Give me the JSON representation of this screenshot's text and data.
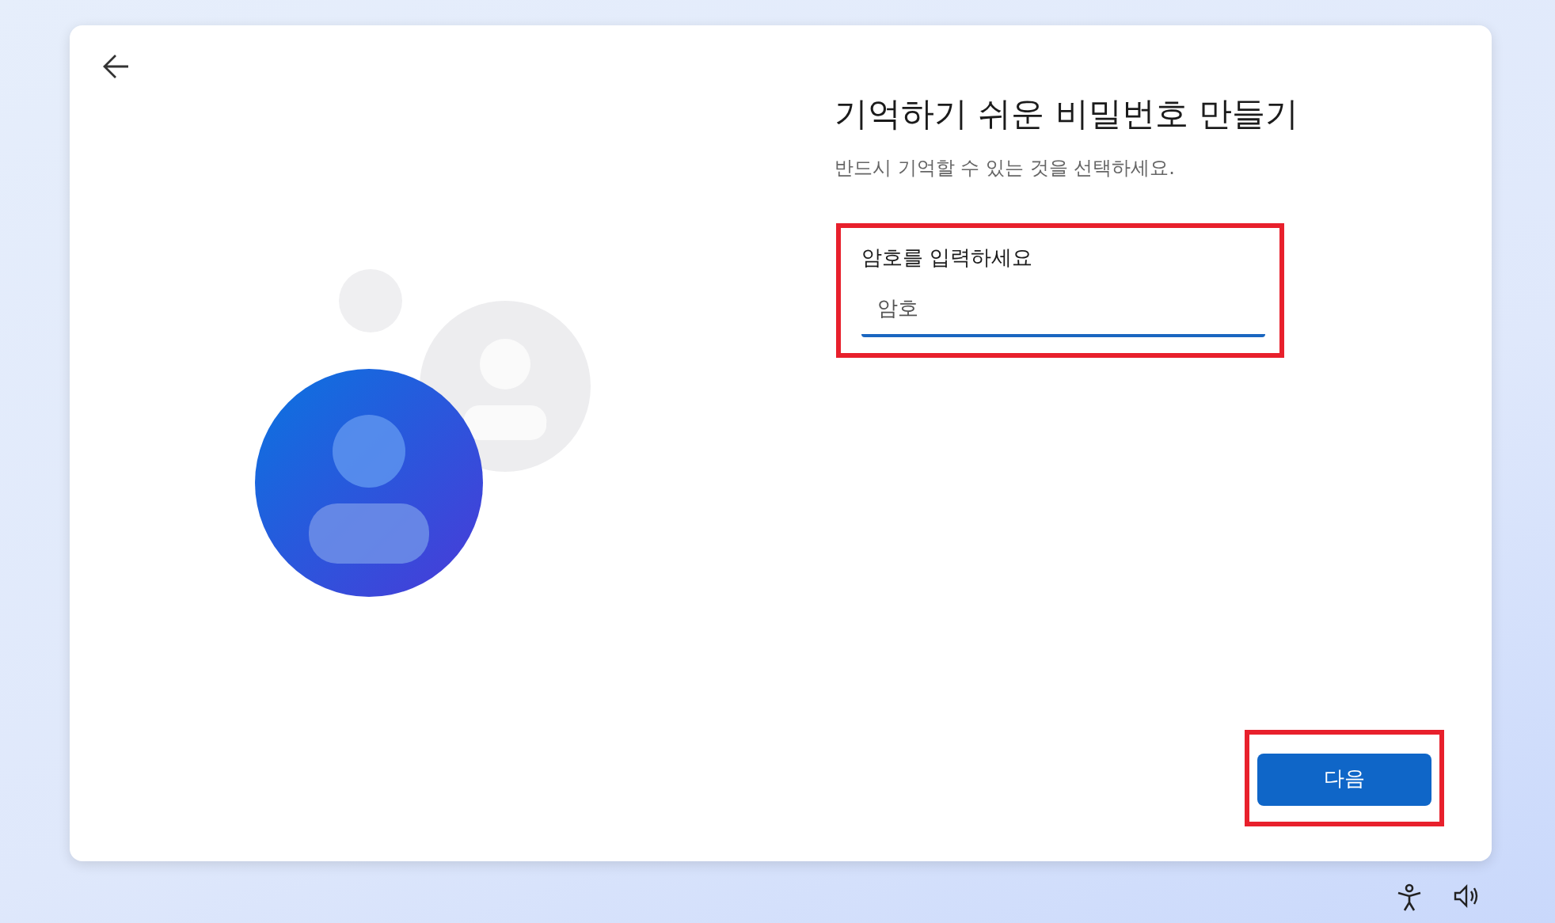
{
  "title": "기억하기 쉬운 비밀번호 만들기",
  "subtitle": "반드시 기억할 수 있는 것을 선택하세요.",
  "password_field": {
    "label": "암호를 입력하세요",
    "placeholder": "암호",
    "highlighted": true
  },
  "next_button": {
    "label": "다음",
    "highlighted": true
  }
}
